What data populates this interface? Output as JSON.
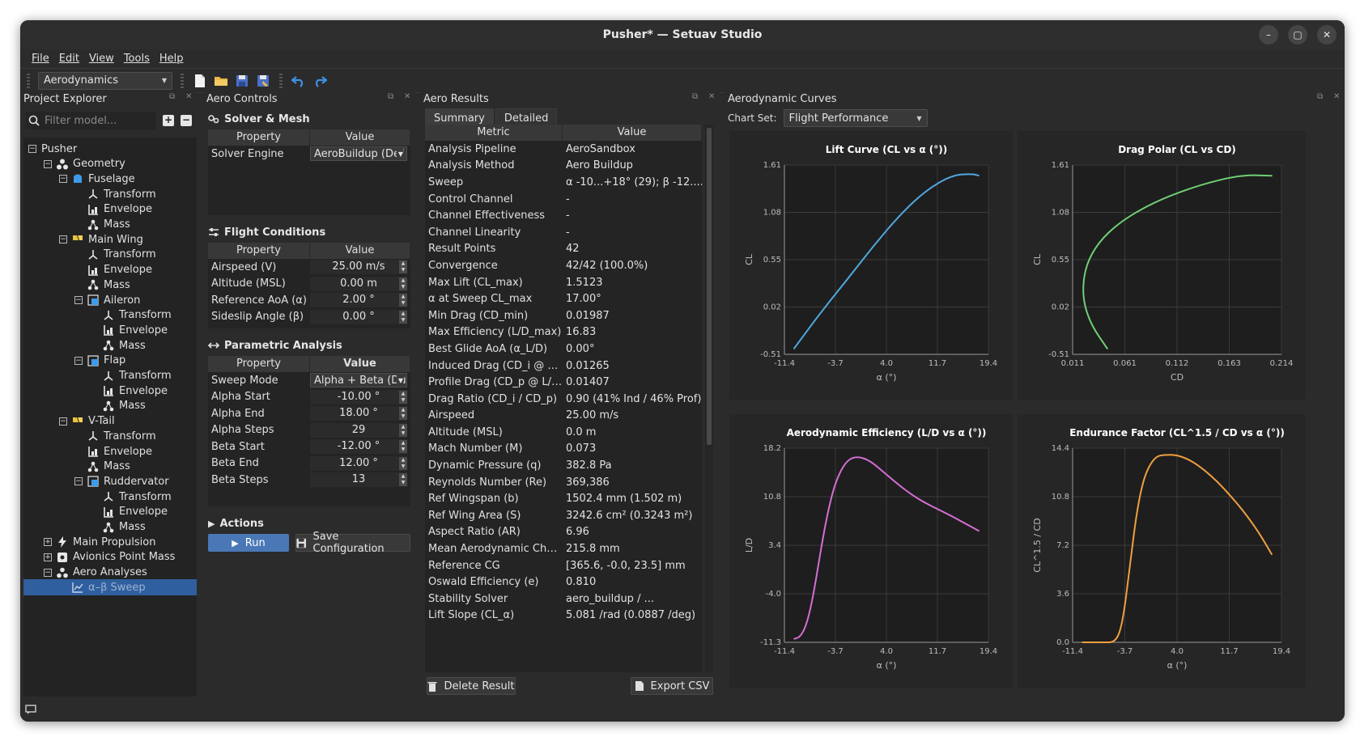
{
  "window": {
    "title": "Pusher* — Setuav Studio"
  },
  "menu": [
    "File",
    "Edit",
    "View",
    "Tools",
    "Help"
  ],
  "toolbar": {
    "workspace": "Aerodynamics"
  },
  "explorer": {
    "title": "Project Explorer",
    "filter_placeholder": "Filter model...",
    "tree": [
      {
        "label": "Pusher",
        "depth": 0,
        "icon": "none",
        "exp": "minus"
      },
      {
        "label": "Geometry",
        "depth": 1,
        "icon": "geometry-icon",
        "exp": "minus"
      },
      {
        "label": "Fuselage",
        "depth": 2,
        "icon": "fuselage-icon",
        "exp": "minus"
      },
      {
        "label": "Transform",
        "depth": 3,
        "icon": "transform-icon",
        "exp": "none"
      },
      {
        "label": "Envelope",
        "depth": 3,
        "icon": "envelope-icon",
        "exp": "none"
      },
      {
        "label": "Mass",
        "depth": 3,
        "icon": "mass-icon",
        "exp": "none"
      },
      {
        "label": "Main Wing",
        "depth": 2,
        "icon": "wing-icon",
        "exp": "minus"
      },
      {
        "label": "Transform",
        "depth": 3,
        "icon": "transform-icon",
        "exp": "none"
      },
      {
        "label": "Envelope",
        "depth": 3,
        "icon": "envelope-icon",
        "exp": "none"
      },
      {
        "label": "Mass",
        "depth": 3,
        "icon": "mass-icon",
        "exp": "none"
      },
      {
        "label": "Aileron",
        "depth": 3,
        "icon": "control-surface-icon",
        "exp": "minus"
      },
      {
        "label": "Transform",
        "depth": 4,
        "icon": "transform-icon",
        "exp": "none"
      },
      {
        "label": "Envelope",
        "depth": 4,
        "icon": "envelope-icon",
        "exp": "none"
      },
      {
        "label": "Mass",
        "depth": 4,
        "icon": "mass-icon",
        "exp": "none"
      },
      {
        "label": "Flap",
        "depth": 3,
        "icon": "control-surface-icon",
        "exp": "minus"
      },
      {
        "label": "Transform",
        "depth": 4,
        "icon": "transform-icon",
        "exp": "none"
      },
      {
        "label": "Envelope",
        "depth": 4,
        "icon": "envelope-icon",
        "exp": "none"
      },
      {
        "label": "Mass",
        "depth": 4,
        "icon": "mass-icon",
        "exp": "none"
      },
      {
        "label": "V-Tail",
        "depth": 2,
        "icon": "wing-icon",
        "exp": "minus"
      },
      {
        "label": "Transform",
        "depth": 3,
        "icon": "transform-icon",
        "exp": "none"
      },
      {
        "label": "Envelope",
        "depth": 3,
        "icon": "envelope-icon",
        "exp": "none"
      },
      {
        "label": "Mass",
        "depth": 3,
        "icon": "mass-icon",
        "exp": "none"
      },
      {
        "label": "Ruddervator",
        "depth": 3,
        "icon": "control-surface-icon",
        "exp": "minus"
      },
      {
        "label": "Transform",
        "depth": 4,
        "icon": "transform-icon",
        "exp": "none"
      },
      {
        "label": "Envelope",
        "depth": 4,
        "icon": "envelope-icon",
        "exp": "none"
      },
      {
        "label": "Mass",
        "depth": 4,
        "icon": "mass-icon",
        "exp": "none"
      },
      {
        "label": "Main Propulsion",
        "depth": 1,
        "icon": "propulsion-icon",
        "exp": "plus"
      },
      {
        "label": "Avionics Point Mass",
        "depth": 1,
        "icon": "point-mass-icon",
        "exp": "plus"
      },
      {
        "label": "Aero Analyses",
        "depth": 1,
        "icon": "analyses-icon",
        "exp": "minus"
      },
      {
        "label": "α–β Sweep",
        "depth": 2,
        "icon": "sweep-chart-icon",
        "exp": "none",
        "selected": true
      }
    ]
  },
  "controls": {
    "title": "Aero Controls",
    "solver": {
      "heading": "Solver & Mesh",
      "col_property": "Property",
      "col_value": "Value",
      "rows": [
        {
          "k": "Solver Engine",
          "v": "AeroBuildup (Def",
          "kind": "combo"
        }
      ]
    },
    "flight": {
      "heading": "Flight Conditions",
      "col_property": "Property",
      "col_value": "Value",
      "rows": [
        {
          "k": "Airspeed (V)",
          "v": "25.00 m/s",
          "kind": "spin"
        },
        {
          "k": "Altitude (MSL)",
          "v": "0.00 m",
          "kind": "spin"
        },
        {
          "k": "Reference AoA (α)",
          "v": "2.00 °",
          "kind": "spin"
        },
        {
          "k": "Sideslip Angle (β)",
          "v": "0.00 °",
          "kind": "spin"
        }
      ]
    },
    "parametric": {
      "heading": "Parametric Analysis",
      "col_property": "Property",
      "col_value": "Value",
      "rows": [
        {
          "k": "Sweep Mode",
          "v": "Alpha + Beta (Du",
          "kind": "combo"
        },
        {
          "k": "Alpha Start",
          "v": "-10.00 °",
          "kind": "spin"
        },
        {
          "k": "Alpha End",
          "v": "18.00 °",
          "kind": "spin"
        },
        {
          "k": "Alpha Steps",
          "v": "29",
          "kind": "spin"
        },
        {
          "k": "Beta Start",
          "v": "-12.00 °",
          "kind": "spin"
        },
        {
          "k": "Beta End",
          "v": "12.00 °",
          "kind": "spin"
        },
        {
          "k": "Beta Steps",
          "v": "13",
          "kind": "spin"
        }
      ]
    },
    "actions": {
      "heading": "Actions",
      "run": "Run",
      "save": "Save Configuration"
    }
  },
  "results": {
    "title": "Aero Results",
    "tabs": [
      "Summary",
      "Detailed"
    ],
    "col_metric": "Metric",
    "col_value": "Value",
    "rows": [
      [
        "Analysis Pipeline",
        "AeroSandbox"
      ],
      [
        "Analysis Method",
        "Aero Buildup"
      ],
      [
        "Sweep",
        "α -10...+18° (29); β -12......"
      ],
      [
        "Control Channel",
        "-"
      ],
      [
        "Channel Effectiveness",
        "-"
      ],
      [
        "Channel Linearity",
        "-"
      ],
      [
        "Result Points",
        "42"
      ],
      [
        "Convergence",
        "42/42 (100.0%)"
      ],
      [
        "Max Lift (CL_max)",
        "1.5123"
      ],
      [
        "α at Sweep CL_max",
        "17.00°"
      ],
      [
        "Min Drag (CD_min)",
        "0.01987"
      ],
      [
        "Max Efficiency (L/D_max)",
        "16.83"
      ],
      [
        "Best Glide AoA (α_L/D)",
        "0.00°"
      ],
      [
        "Induced Drag (CD_i @ L/D)",
        "0.01265"
      ],
      [
        "Profile Drag (CD_p @ L/D)",
        "0.01407"
      ],
      [
        "Drag Ratio (CD_i / CD_p)",
        "0.90 (41% Ind / 46% Prof)"
      ],
      [
        "Airspeed",
        "25.00 m/s"
      ],
      [
        "Altitude (MSL)",
        "0.0 m"
      ],
      [
        "Mach Number (M)",
        "0.073"
      ],
      [
        "Dynamic Pressure (q)",
        "382.8 Pa"
      ],
      [
        "Reynolds Number (Re)",
        "369,386"
      ],
      [
        "Ref Wingspan (b)",
        "1502.4 mm (1.502 m)"
      ],
      [
        "Ref Wing Area (S)",
        "3242.6 cm² (0.3243 m²)"
      ],
      [
        "Aspect Ratio (AR)",
        "6.96"
      ],
      [
        "Mean Aerodynamic Chord ...",
        "215.8 mm"
      ],
      [
        "Reference CG",
        "[365.6, -0.0, 23.5] mm"
      ],
      [
        "Oswald Efficiency (e)",
        "0.810"
      ],
      [
        "Stability Solver",
        "aero_buildup / ..."
      ],
      [
        "Lift Slope (CL_α)",
        "5.081 /rad (0.0887 /deg)"
      ]
    ],
    "delete": "Delete Result",
    "export": "Export CSV"
  },
  "curves": {
    "title": "Aerodynamic Curves",
    "chart_set_label": "Chart Set:",
    "chart_set": "Flight Performance"
  },
  "chart_data": [
    {
      "type": "line",
      "title": "Lift Curve (CL vs α (°))",
      "xlabel": "α (°)",
      "ylabel": "CL",
      "xlim": [
        -11.4,
        19.4
      ],
      "ylim": [
        -0.51,
        1.61
      ],
      "xticks": [
        "-11.4",
        "-3.7",
        "4.0",
        "11.7",
        "19.4"
      ],
      "yticks": [
        "-0.51",
        "0.02",
        "0.55",
        "1.08",
        "1.61"
      ],
      "color": "#4fa8e0",
      "x": [
        -10,
        -6,
        -2,
        2,
        6,
        10,
        14,
        17,
        18
      ],
      "y": [
        -0.45,
        -0.05,
        0.32,
        0.7,
        1.05,
        1.33,
        1.5,
        1.51,
        1.49
      ]
    },
    {
      "type": "line",
      "title": "Drag Polar (CL vs CD)",
      "xlabel": "CD",
      "ylabel": "CL",
      "xlim": [
        0.011,
        0.214
      ],
      "ylim": [
        -0.51,
        1.61
      ],
      "xticks": [
        "0.011",
        "0.061",
        "0.112",
        "0.163",
        "0.214"
      ],
      "yticks": [
        "-0.51",
        "0.02",
        "0.55",
        "1.08",
        "1.61"
      ],
      "color": "#6fcf74",
      "x": [
        0.045,
        0.03,
        0.022,
        0.021,
        0.026,
        0.04,
        0.063,
        0.095,
        0.135,
        0.175,
        0.205
      ],
      "y": [
        -0.45,
        -0.2,
        0.05,
        0.3,
        0.55,
        0.8,
        1.02,
        1.22,
        1.39,
        1.5,
        1.49
      ]
    },
    {
      "type": "line",
      "title": "Aerodynamic Efficiency (L/D vs α (°))",
      "xlabel": "α (°)",
      "ylabel": "L/D",
      "xlim": [
        -11.4,
        19.4
      ],
      "ylim": [
        -11.3,
        18.2
      ],
      "xticks": [
        "-11.4",
        "-3.7",
        "4.0",
        "11.7",
        "19.4"
      ],
      "yticks": [
        "-11.3",
        "-4.0",
        "3.4",
        "10.8",
        "18.2"
      ],
      "color": "#d46fd4",
      "x": [
        -10,
        -9,
        -8,
        -7,
        -6,
        -5,
        -4,
        -3,
        -2,
        -1,
        0,
        1,
        2,
        4,
        6,
        8,
        10,
        12,
        14,
        16,
        18
      ],
      "y": [
        -10.8,
        -10.5,
        -8.5,
        -4,
        2.2,
        7.8,
        12,
        14.6,
        16.2,
        16.8,
        16.83,
        16.5,
        15.9,
        14.2,
        12.5,
        11,
        9.8,
        8.8,
        7.8,
        6.7,
        5.6
      ]
    },
    {
      "type": "line",
      "title": "Endurance Factor (CL^1.5 / CD vs α (°))",
      "xlabel": "α (°)",
      "ylabel": "CL^1.5 / CD",
      "xlim": [
        -11.4,
        19.4
      ],
      "ylim": [
        0.0,
        14.4
      ],
      "xticks": [
        "-11.4",
        "-3.7",
        "4.0",
        "11.7",
        "19.4"
      ],
      "yticks": [
        "0.0",
        "3.6",
        "7.2",
        "10.8",
        "14.4"
      ],
      "color": "#f0a040",
      "x": [
        -10,
        -7,
        -5,
        -4,
        -3,
        -2,
        -1,
        0,
        1,
        2,
        4,
        6,
        8,
        10,
        12,
        14,
        16,
        18
      ],
      "y": [
        0,
        0,
        0,
        1.5,
        5.5,
        9.5,
        12,
        13.2,
        13.8,
        13.9,
        13.9,
        13.5,
        12.8,
        11.9,
        10.8,
        9.6,
        8.2,
        6.5
      ]
    }
  ]
}
